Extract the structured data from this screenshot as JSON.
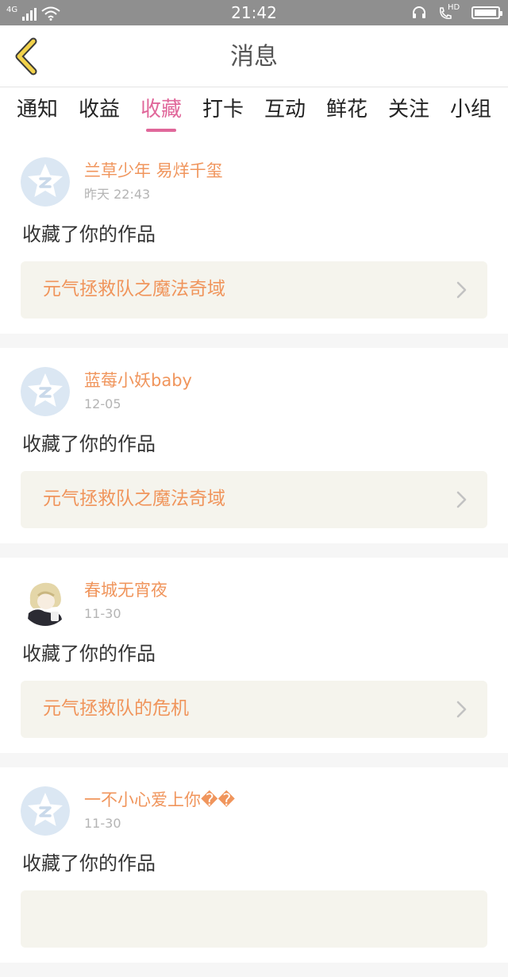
{
  "status_bar": {
    "network": "4G",
    "time": "21:42",
    "hd": "HD",
    "battery_level": 0.95
  },
  "header": {
    "title": "消息"
  },
  "tabs": [
    {
      "label": "通知",
      "active": false
    },
    {
      "label": "收益",
      "active": false
    },
    {
      "label": "收藏",
      "active": true
    },
    {
      "label": "打卡",
      "active": false
    },
    {
      "label": "互动",
      "active": false
    },
    {
      "label": "鲜花",
      "active": false
    },
    {
      "label": "关注",
      "active": false
    },
    {
      "label": "小组",
      "active": false
    }
  ],
  "messages": [
    {
      "user": "兰草少年 易烊千玺",
      "time": "昨天 22:43",
      "action": "收藏了你的作品",
      "work": "元气拯救队之魔法奇域",
      "avatar": "default-avatar"
    },
    {
      "user": "蓝莓小妖baby",
      "time": "12-05",
      "action": "收藏了你的作品",
      "work": "元气拯救队之魔法奇域",
      "avatar": "default-avatar"
    },
    {
      "user": "春城无宵夜",
      "time": "11-30",
      "action": "收藏了你的作品",
      "work": "元气拯救队的危机",
      "avatar": "anime-avatar"
    },
    {
      "user": "一不小心爱上你��",
      "time": "11-30",
      "action": "收藏了你的作品",
      "work": "",
      "avatar": "default-avatar"
    }
  ],
  "colors": {
    "accent_pink": "#e0679a",
    "name_orange": "#f0955c",
    "back_arrow": "#f2d24a",
    "link_bg": "#f5f4ed",
    "status_bar": "#8f8f8f"
  }
}
